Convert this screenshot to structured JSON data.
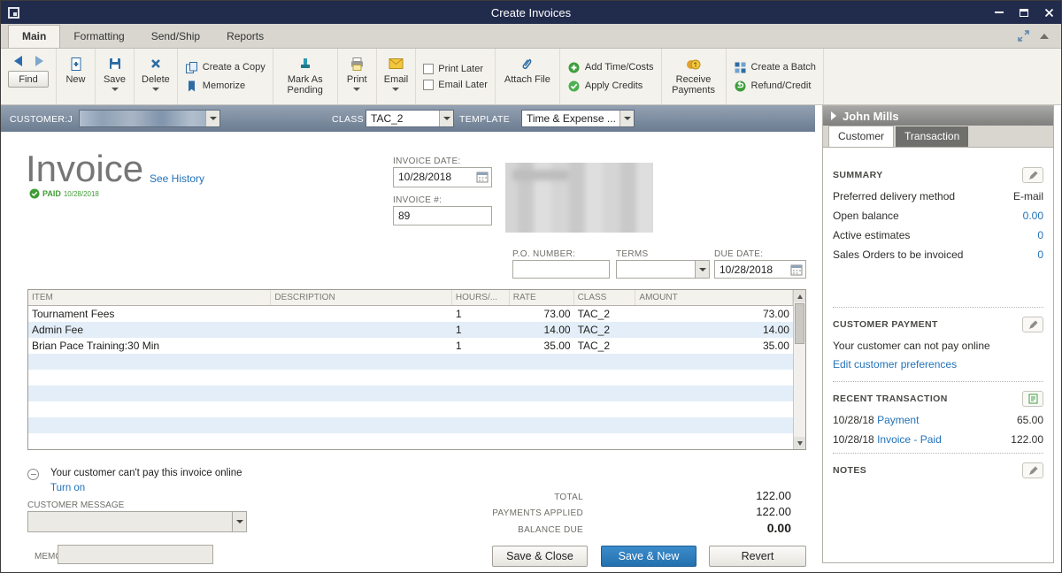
{
  "window": {
    "title": "Create Invoices"
  },
  "ribbon_tabs": [
    {
      "label": "Main"
    },
    {
      "label": "Formatting"
    },
    {
      "label": "Send/Ship"
    },
    {
      "label": "Reports"
    }
  ],
  "toolbar": {
    "find_label": "Find",
    "new_label": "New",
    "save_label": "Save",
    "delete_label": "Delete",
    "create_copy_label": "Create a Copy",
    "memorize_label": "Memorize",
    "mark_pending_label": "Mark As Pending",
    "print_label": "Print",
    "email_label": "Email",
    "print_later_label": "Print Later",
    "email_later_label": "Email Later",
    "attach_file_label": "Attach File",
    "add_time_costs_label": "Add Time/Costs",
    "apply_credits_label": "Apply Credits",
    "receive_payments_label": "Receive Payments",
    "create_batch_label": "Create a Batch",
    "refund_credit_label": "Refund/Credit"
  },
  "form_header": {
    "customer_label": "CUSTOMER:J",
    "class_label": "CLASS",
    "class_value": "TAC_2",
    "template_label": "TEMPLATE",
    "template_value": "Time & Expense ..."
  },
  "invoice": {
    "title": "Invoice",
    "see_history_link": "See History",
    "paid_label": "PAID",
    "paid_date": "10/28/2018",
    "date_label": "INVOICE DATE:",
    "date_value": "10/28/2018",
    "number_label": "INVOICE #:",
    "number_value": "89",
    "po_number_label": "P.O. NUMBER:",
    "terms_label": "TERMS",
    "due_date_label": "DUE DATE:",
    "due_date_value": "10/28/2018"
  },
  "items_table": {
    "columns": [
      "ITEM",
      "DESCRIPTION",
      "HOURS/...",
      "RATE",
      "CLASS",
      "AMOUNT"
    ],
    "rows": [
      {
        "item": "Tournament Fees",
        "description": "",
        "hours": "1",
        "rate": "73.00",
        "class": "TAC_2",
        "amount": "73.00"
      },
      {
        "item": "Admin Fee",
        "description": "",
        "hours": "1",
        "rate": "14.00",
        "class": "TAC_2",
        "amount": "14.00"
      },
      {
        "item": "Brian Pace Training:30 Min",
        "description": "",
        "hours": "1",
        "rate": "35.00",
        "class": "TAC_2",
        "amount": "35.00"
      }
    ]
  },
  "footer": {
    "online_payment_text": "Your customer can't pay this invoice online",
    "turn_on_link": "Turn on",
    "customer_message_label": "CUSTOMER MESSAGE",
    "memo_label": "MEMO",
    "total_label": "TOTAL",
    "total_value": "122.00",
    "payments_applied_label": "PAYMENTS APPLIED",
    "payments_applied_value": "122.00",
    "balance_due_label": "BALANCE DUE",
    "balance_due_value": "0.00",
    "save_close_button": "Save & Close",
    "save_new_button": "Save & New",
    "revert_button": "Revert"
  },
  "sidebar": {
    "customer_name": "John Mills",
    "tab_customer": "Customer",
    "tab_transaction": "Transaction",
    "summary_heading": "SUMMARY",
    "summary_rows": [
      {
        "label": "Preferred delivery method",
        "value": "E-mail"
      },
      {
        "label": "Open balance",
        "value": "0.00"
      },
      {
        "label": "Active estimates",
        "value": "0"
      },
      {
        "label": "Sales Orders to be invoiced",
        "value": "0"
      }
    ],
    "customer_payment_heading": "CUSTOMER PAYMENT",
    "customer_payment_text": "Your customer can not pay online",
    "customer_payment_link": "Edit customer preferences",
    "recent_transaction_heading": "RECENT TRANSACTION",
    "recent_transactions": [
      {
        "date": "10/28/18",
        "link": "Payment",
        "amount": "65.00"
      },
      {
        "date": "10/28/18",
        "link": "Invoice - Paid",
        "amount": "122.00"
      }
    ],
    "notes_heading": "NOTES"
  }
}
